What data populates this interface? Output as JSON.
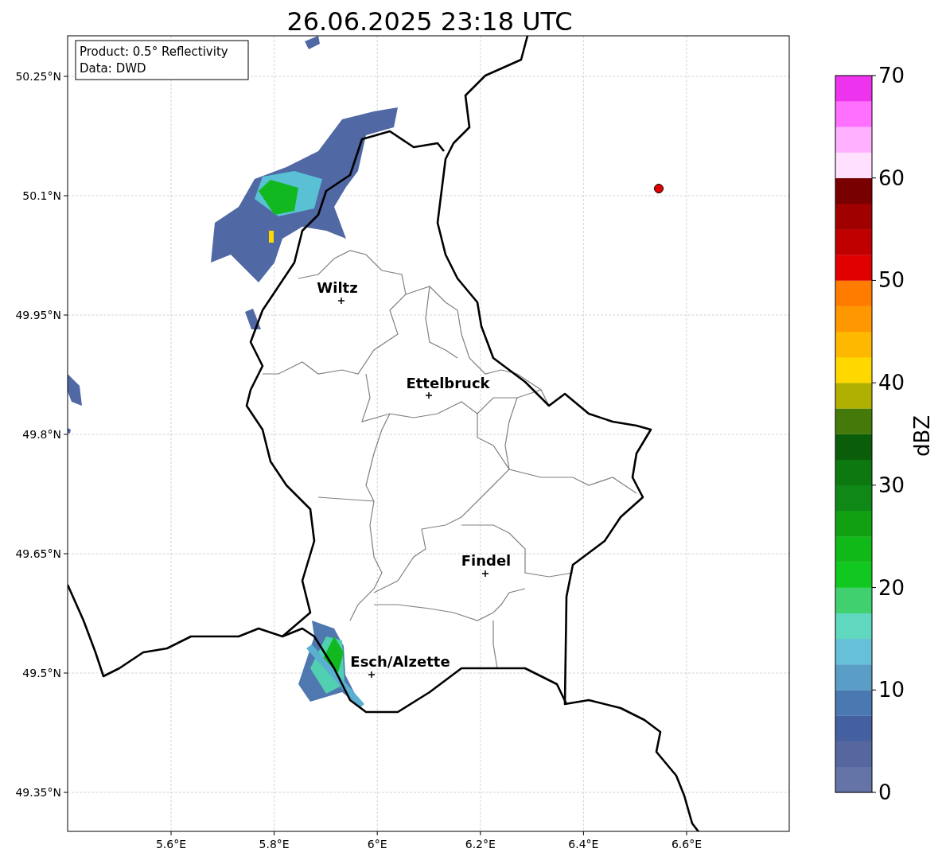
{
  "title": "26.06.2025 23:18 UTC",
  "info_box": [
    "Product: 0.5° Reflectivity",
    "Data: DWD"
  ],
  "lat_labels": [
    "50.25°N",
    "50.1°N",
    "49.95°N",
    "49.8°N",
    "49.65°N",
    "49.5°N",
    "49.35°N"
  ],
  "lon_labels": [
    "5.6°E",
    "5.8°E",
    "6°E",
    "6.2°E",
    "6.4°E",
    "6.6°E"
  ],
  "cities": [
    {
      "name": "Wiltz"
    },
    {
      "name": "Ettelbruck"
    },
    {
      "name": "Findel"
    },
    {
      "name": "Esch/Alzette"
    }
  ],
  "colorbar": {
    "label": "dBZ",
    "ticks": [
      "70",
      "60",
      "50",
      "40",
      "30",
      "20",
      "10",
      "0"
    ],
    "bands": [
      {
        "color": "#6474a6"
      },
      {
        "color": "#56679f"
      },
      {
        "color": "#4560a0"
      },
      {
        "color": "#4a78b0"
      },
      {
        "color": "#5a9ec8"
      },
      {
        "color": "#66c0d8"
      },
      {
        "color": "#60d8c0"
      },
      {
        "color": "#40d070"
      },
      {
        "color": "#10c820"
      },
      {
        "color": "#10b818"
      },
      {
        "color": "#10a010"
      },
      {
        "color": "#108818"
      },
      {
        "color": "#0e7810"
      },
      {
        "color": "#0a5e0a"
      },
      {
        "color": "#447a0a"
      },
      {
        "color": "#b0b000"
      },
      {
        "color": "#ffd800"
      },
      {
        "color": "#ffb800"
      },
      {
        "color": "#ff9800"
      },
      {
        "color": "#ff7c00"
      },
      {
        "color": "#e00000"
      },
      {
        "color": "#c00000"
      },
      {
        "color": "#a00000"
      },
      {
        "color": "#780000"
      },
      {
        "color": "#ffe0ff"
      },
      {
        "color": "#ffb0ff"
      },
      {
        "color": "#ff70ff"
      },
      {
        "color": "#ee33ee"
      }
    ]
  }
}
